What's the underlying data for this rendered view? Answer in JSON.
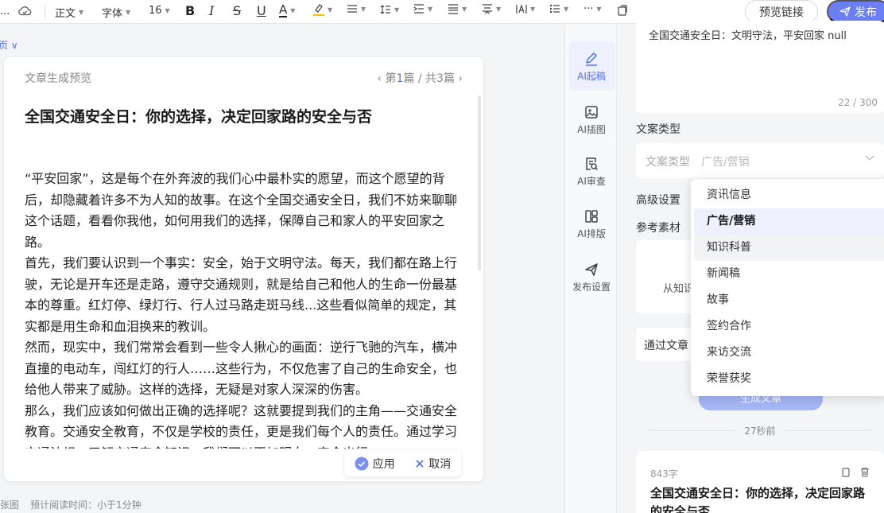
{
  "toolbar": {
    "ellipsis": "...",
    "paragraph_style": "正文",
    "font_family": "字体",
    "font_size": "16",
    "bold": "B",
    "italic": "I",
    "strike": "S",
    "underline": "U",
    "font_color": "A",
    "more": "···",
    "preview_link": "预览链接",
    "publish": "发布"
  },
  "breadcrumb": "页 ∨",
  "preview": {
    "heading": "文章生成预览",
    "pager_prefix": "‹ 第",
    "pager_current": "1",
    "pager_suffix": "篇 / 共3篇 ›",
    "title": "全国交通安全日：你的选择，决定回家路的安全与否",
    "paragraphs": [
      "“平安回家”，这是每个在外奔波的我们心中最朴实的愿望，而这个愿望的背后，却隐藏着许多不为人知的故事。在这个全国交通安全日，我们不妨来聊聊这个话题，看看你我他，如何用我们的选择，保障自己和家人的平安回家之路。",
      "首先，我们要认识到一个事实：安全，始于文明守法。每天，我们都在路上行驶，无论是开车还是走路，遵守交通规则，就是给自己和他人的生命一份最基本的尊重。红灯停、绿灯行、行人过马路走斑马线...这些看似简单的规定，其实都是用生命和血泪换来的教训。",
      "然而，现实中，我们常常会看到一些令人揪心的画面：逆行飞驰的汽车，横冲直撞的电动车，闯红灯的行人……这些行为，不仅危害了自己的生命安全，也给他人带来了威胁。这样的选择，无疑是对家人深深的伤害。",
      "那么，我们应该如何做出正确的选择呢？这就要提到我们的主角——交通安全教育。交通安全教育，不仅是学校的责任，更是我们每个人的责任。通过学习交通法规，了解交通安全知识，我们可以更加明白，安全出行"
    ],
    "apply": "应用",
    "cancel": "取消"
  },
  "statusbar": {
    "left": "张图",
    "reading_time": "预计阅读时间：小于1分钟"
  },
  "rail": [
    {
      "label": "AI起稿",
      "icon": "pen-icon"
    },
    {
      "label": "AI插图",
      "icon": "image-icon"
    },
    {
      "label": "AI审查",
      "icon": "review-icon"
    },
    {
      "label": "AI排版",
      "icon": "layout-icon"
    },
    {
      "label": "发布设置",
      "icon": "send-icon"
    }
  ],
  "panel": {
    "prompt_text": "全国交通安全日：文明守法，平安回家 null",
    "prompt_counter": "22 / 300",
    "copy_type_label": "文案类型",
    "copy_type_key": "文案类型",
    "copy_type_value": "广告/营销",
    "advanced_label": "高级设置",
    "material_label": "参考素材",
    "material_hint": "从知识",
    "through_label": "通过文章",
    "generate_button": "生成文章",
    "time_ago": "27秒前",
    "result_wordcount": "843字",
    "result_title": "全国交通安全日：你的选择，决定回家路的安全与否"
  },
  "dropdown": {
    "options": [
      "资讯信息",
      "广告/营销",
      "知识科普",
      "新闻稿",
      "故事",
      "签约合作",
      "来访交流",
      "荣誉获奖"
    ],
    "selected": "广告/营销",
    "hovered": "知识科普"
  },
  "colors": {
    "accent": "#5470e8",
    "publish_bg": "#6a7ff4"
  }
}
